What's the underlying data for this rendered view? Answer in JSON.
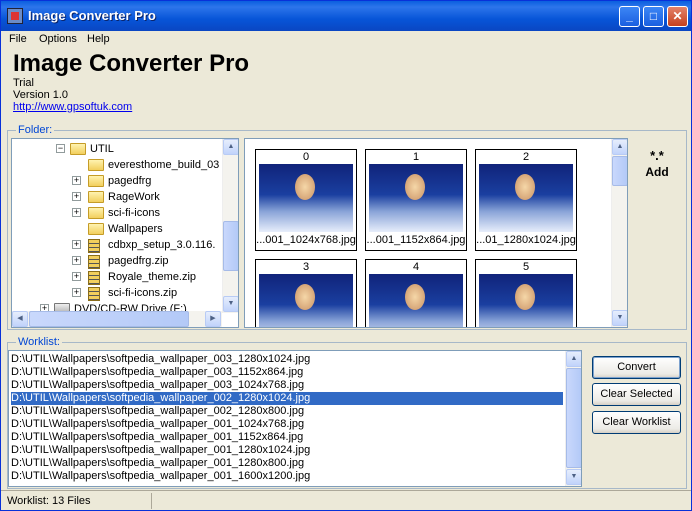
{
  "window": {
    "title": "Image Converter Pro"
  },
  "menu": [
    "File",
    "Options",
    "Help"
  ],
  "header": {
    "app_name": "Image Converter Pro",
    "edition": "Trial",
    "version": "Version 1.0",
    "url": "http://www.gpsoftuk.com"
  },
  "folder": {
    "label": "Folder:",
    "tree": [
      {
        "label": "UTIL",
        "type": "folder-open",
        "expander": "−"
      },
      {
        "label": "everesthome_build_03",
        "type": "folder",
        "expander": ""
      },
      {
        "label": "pagedfrg",
        "type": "folder",
        "expander": "+"
      },
      {
        "label": "RageWork",
        "type": "folder",
        "expander": "+"
      },
      {
        "label": "sci-fi-icons",
        "type": "folder",
        "expander": "+"
      },
      {
        "label": "Wallpapers",
        "type": "folder-open",
        "expander": ""
      },
      {
        "label": "cdbxp_setup_3.0.116.",
        "type": "zip",
        "expander": "+"
      },
      {
        "label": "pagedfrg.zip",
        "type": "zip",
        "expander": "+"
      },
      {
        "label": "Royale_theme.zip",
        "type": "zip",
        "expander": "+"
      },
      {
        "label": "sci-fi-icons.zip",
        "type": "zip",
        "expander": "+"
      },
      {
        "label": "DVD/CD-RW Drive (F:)",
        "type": "drive",
        "expander": "+"
      }
    ]
  },
  "thumbnails": [
    {
      "num": "0",
      "caption": "...001_1024x768.jpg"
    },
    {
      "num": "1",
      "caption": "...001_1152x864.jpg"
    },
    {
      "num": "2",
      "caption": "...01_1280x1024.jpg"
    },
    {
      "num": "3",
      "caption": ""
    },
    {
      "num": "4",
      "caption": ""
    },
    {
      "num": "5",
      "caption": ""
    }
  ],
  "add": {
    "pattern": "*.*",
    "label": "Add"
  },
  "worklist": {
    "label": "Worklist:",
    "items": [
      "D:\\UTIL\\Wallpapers\\softpedia_wallpaper_003_1280x1024.jpg",
      "D:\\UTIL\\Wallpapers\\softpedia_wallpaper_003_1152x864.jpg",
      "D:\\UTIL\\Wallpapers\\softpedia_wallpaper_003_1024x768.jpg",
      "D:\\UTIL\\Wallpapers\\softpedia_wallpaper_002_1280x1024.jpg",
      "D:\\UTIL\\Wallpapers\\softpedia_wallpaper_002_1280x800.jpg",
      "D:\\UTIL\\Wallpapers\\softpedia_wallpaper_001_1024x768.jpg",
      "D:\\UTIL\\Wallpapers\\softpedia_wallpaper_001_1152x864.jpg",
      "D:\\UTIL\\Wallpapers\\softpedia_wallpaper_001_1280x1024.jpg",
      "D:\\UTIL\\Wallpapers\\softpedia_wallpaper_001_1280x800.jpg",
      "D:\\UTIL\\Wallpapers\\softpedia_wallpaper_001_1600x1200.jpg"
    ],
    "selected_index": 3
  },
  "buttons": {
    "convert": "Convert",
    "clear_selected": "Clear Selected",
    "clear_worklist": "Clear Worklist"
  },
  "status": {
    "text": "Worklist: 13 Files"
  },
  "colors": {
    "title_bar": "#0a5fdf",
    "selection": "#316ac5",
    "group_label": "#0046d5"
  }
}
